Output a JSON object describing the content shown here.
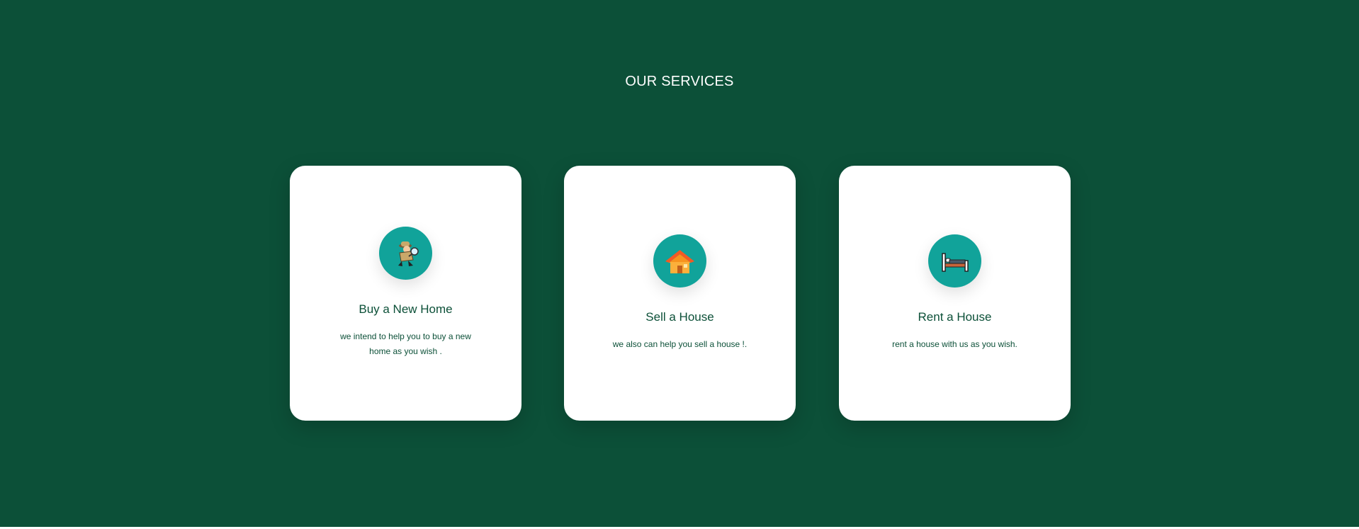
{
  "section": {
    "title": "OUR SERVICES"
  },
  "colors": {
    "background": "#0c5038",
    "card": "#ffffff",
    "icon_circle": "#11a39a",
    "text": "#0c5038"
  },
  "services": [
    {
      "icon": "detective-search-icon",
      "title": "Buy a New Home",
      "description": "we intend to help you to buy a new home as you wish ."
    },
    {
      "icon": "house-icon",
      "title": "Sell a House",
      "description": "we also can help you sell a house !."
    },
    {
      "icon": "bed-icon",
      "title": "Rent a House",
      "description": "rent a house with us as you wish."
    }
  ]
}
